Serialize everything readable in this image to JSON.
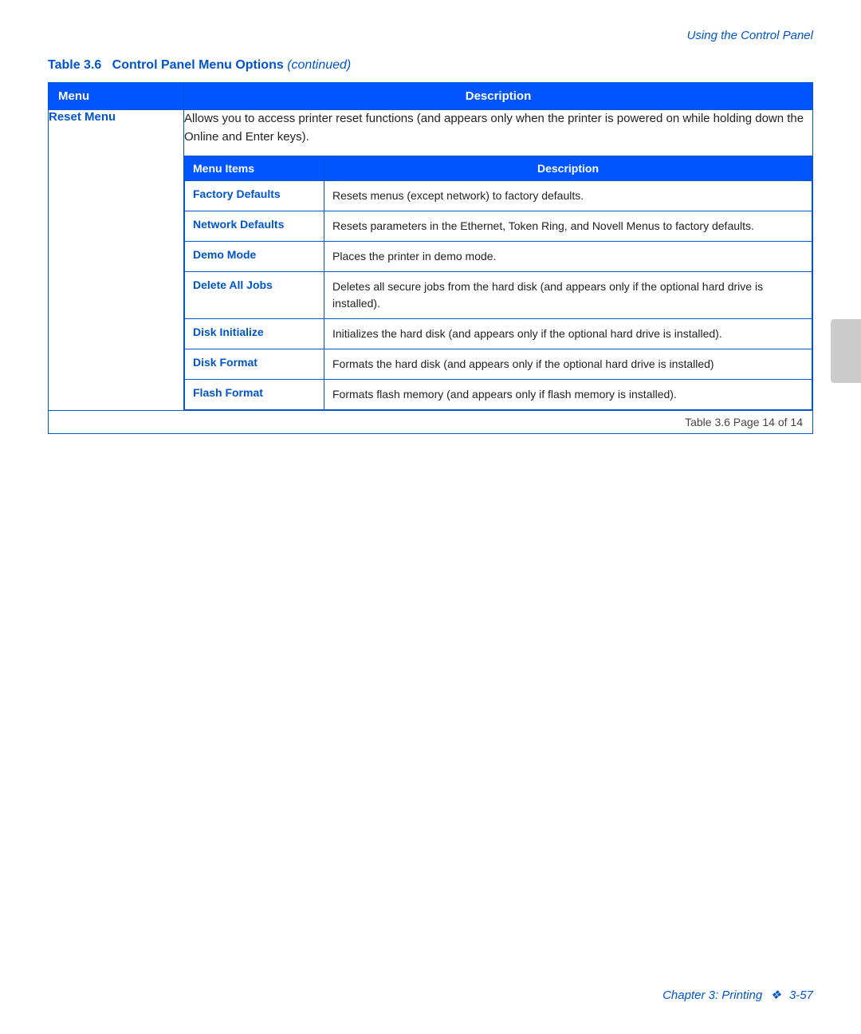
{
  "header": {
    "text": "Using the Control Panel"
  },
  "table_title": {
    "label": "Table 3.6",
    "bold_part": "Control Panel Menu Options",
    "italic_part": "(continued)"
  },
  "columns": {
    "menu": "Menu",
    "description": "Description"
  },
  "reset_menu": {
    "label": "Reset Menu",
    "description": "Allows you to access printer reset functions (and appears only when the printer is powered on while holding down the Online and Enter keys).",
    "inner_columns": {
      "menu_items": "Menu Items",
      "description": "Description"
    },
    "items": [
      {
        "label": "Factory Defaults",
        "description": "Resets menus (except network) to factory defaults."
      },
      {
        "label": "Network Defaults",
        "description": "Resets parameters in the Ethernet, Token Ring, and Novell Menus to factory defaults."
      },
      {
        "label": "Demo Mode",
        "description": "Places the printer in demo mode."
      },
      {
        "label": "Delete All Jobs",
        "description": "Deletes all secure jobs from the hard disk (and appears only if the optional hard drive is installed)."
      },
      {
        "label": "Disk Initialize",
        "description": "Initializes the hard disk (and appears only if the optional hard drive is installed)."
      },
      {
        "label": "Disk Format",
        "description": "Formats the hard disk (and appears only if the optional hard drive is installed)"
      },
      {
        "label": "Flash Format",
        "description": "Formats flash memory (and appears only if flash memory is installed)."
      }
    ]
  },
  "pagination": {
    "text": "Table 3.6  Page 14 of 14"
  },
  "footer": {
    "chapter": "Chapter 3: Printing",
    "separator": "❖",
    "page": "3-57"
  }
}
